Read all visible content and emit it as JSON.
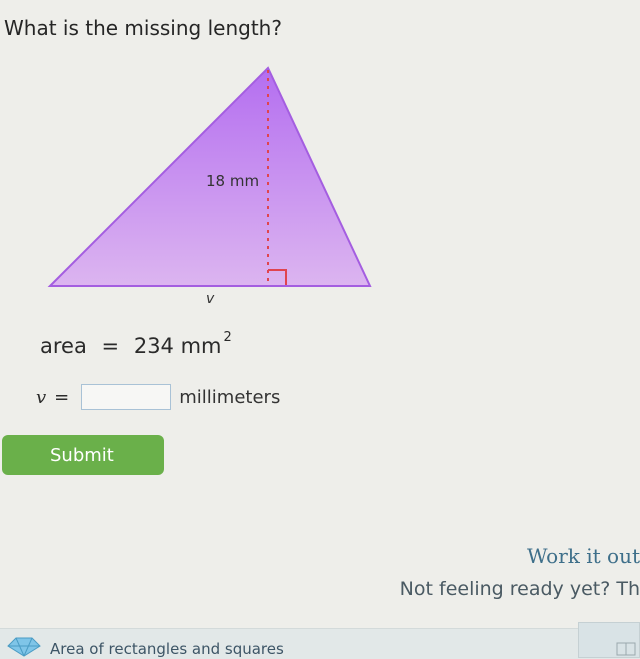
{
  "question": "What is the missing length?",
  "figure": {
    "height_label": "18 mm",
    "base_label": "v"
  },
  "area": {
    "label": "area",
    "equals": "=",
    "value": "234 mm",
    "exponent": "2"
  },
  "answer": {
    "variable": "v",
    "equals": "=",
    "value": "",
    "placeholder": "",
    "unit": "millimeters"
  },
  "submit_label": "Submit",
  "work_it_out": "Work it out",
  "not_ready": "Not feeling ready yet? Th",
  "topic_link": "Area of rectangles and squares",
  "colors": {
    "triangle_fill": "#c48ee8",
    "triangle_stroke": "#a45ee0",
    "height_line": "#e0444f",
    "submit_bg": "#6ab04a"
  },
  "icons": {
    "topic": "shapes-icon",
    "corner": "dictionary-icon"
  }
}
